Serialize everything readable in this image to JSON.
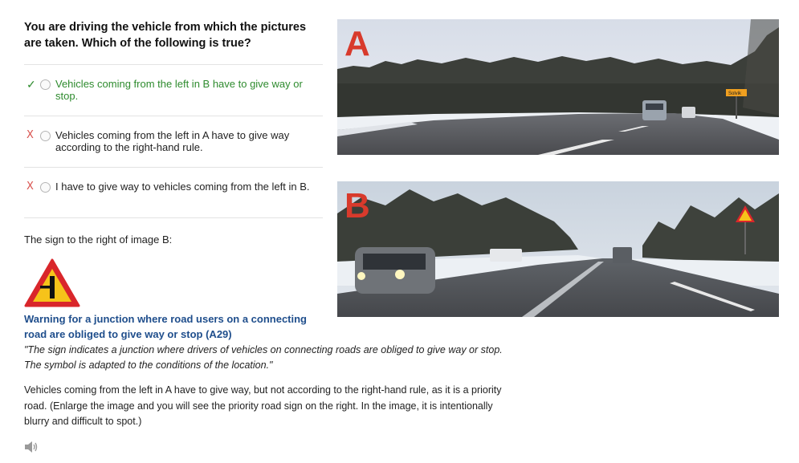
{
  "question": "You are driving the vehicle from which the pictures are taken. Which of the following is true?",
  "options": [
    {
      "mark": "✓",
      "text": "Vehicles coming from the left in B have to give way or stop.",
      "correct": true
    },
    {
      "mark": "X",
      "text": "Vehicles coming from the left in A have to give way according to the right-hand rule.",
      "correct": false
    },
    {
      "mark": "X",
      "text": "I have to give way to vehicles coming from the left in B.",
      "correct": false
    }
  ],
  "sign_caption": "The sign to the right of image B:",
  "sign_title": "Warning for a junction where road users on a connecting road are obliged to give way or stop (A29)",
  "sign_quote": "\"The sign indicates a junction where drivers of vehicles on connecting roads are obliged to give way or stop. The symbol is adapted to the conditions of the location.\"",
  "explanation": "Vehicles coming from the left in A have to give way, but not according to the right-hand rule, as it is a priority road. (Enlarge the image and you will see the priority road sign on the right. In the image, it is intentionally blurry and difficult to spot.)",
  "images": {
    "a_label": "A",
    "b_label": "B",
    "a_sign_text": "Solvik"
  },
  "icons": {
    "correct": "check-icon",
    "incorrect": "x-icon",
    "audio": "speaker-icon"
  },
  "colors": {
    "correct_green": "#2e8b2e",
    "incorrect_red": "#d9534f",
    "sign_title_blue": "#1f4e8c",
    "label_red": "#d83a2c",
    "warning_sign_red": "#d9262b",
    "warning_sign_yellow": "#f6c31a"
  }
}
